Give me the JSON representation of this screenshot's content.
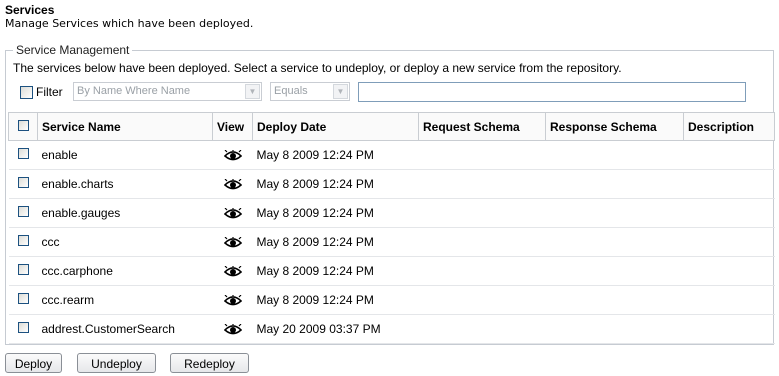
{
  "page": {
    "title": "Services",
    "subtitle": "Manage Services which have been deployed."
  },
  "management": {
    "legend": "Service Management",
    "intro": "The services below have been deployed. Select a service to undeploy, or deploy a new service from the repository."
  },
  "filter": {
    "label": "Filter",
    "field_select": "By Name Where Name",
    "operator_select": "Equals",
    "value": ""
  },
  "table": {
    "columns": [
      "Service Name",
      "View",
      "Deploy Date",
      "Request Schema",
      "Response Schema",
      "Description"
    ],
    "rows": [
      {
        "name": "enable",
        "deploy_date": "May 8 2009 12:24 PM",
        "request_schema": "",
        "response_schema": "",
        "description": ""
      },
      {
        "name": "enable.charts",
        "deploy_date": "May 8 2009 12:24 PM",
        "request_schema": "",
        "response_schema": "",
        "description": ""
      },
      {
        "name": "enable.gauges",
        "deploy_date": "May 8 2009 12:24 PM",
        "request_schema": "",
        "response_schema": "",
        "description": ""
      },
      {
        "name": "ccc",
        "deploy_date": "May 8 2009 12:24 PM",
        "request_schema": "",
        "response_schema": "",
        "description": ""
      },
      {
        "name": "ccc.carphone",
        "deploy_date": "May 8 2009 12:24 PM",
        "request_schema": "",
        "response_schema": "",
        "description": ""
      },
      {
        "name": "ccc.rearm",
        "deploy_date": "May 8 2009 12:24 PM",
        "request_schema": "",
        "response_schema": "",
        "description": ""
      },
      {
        "name": "addrest.CustomerSearch",
        "deploy_date": "May 20 2009 03:37 PM",
        "request_schema": "",
        "response_schema": "",
        "description": ""
      }
    ],
    "view_icon": "eye-icon"
  },
  "buttons": {
    "deploy": "Deploy",
    "undeploy": "Undeploy",
    "redeploy": "Redeploy"
  },
  "colors": {
    "fieldset_border": "#c6cbd2",
    "checkbox_border": "#1c5180",
    "input_border": "#7f9db9"
  }
}
